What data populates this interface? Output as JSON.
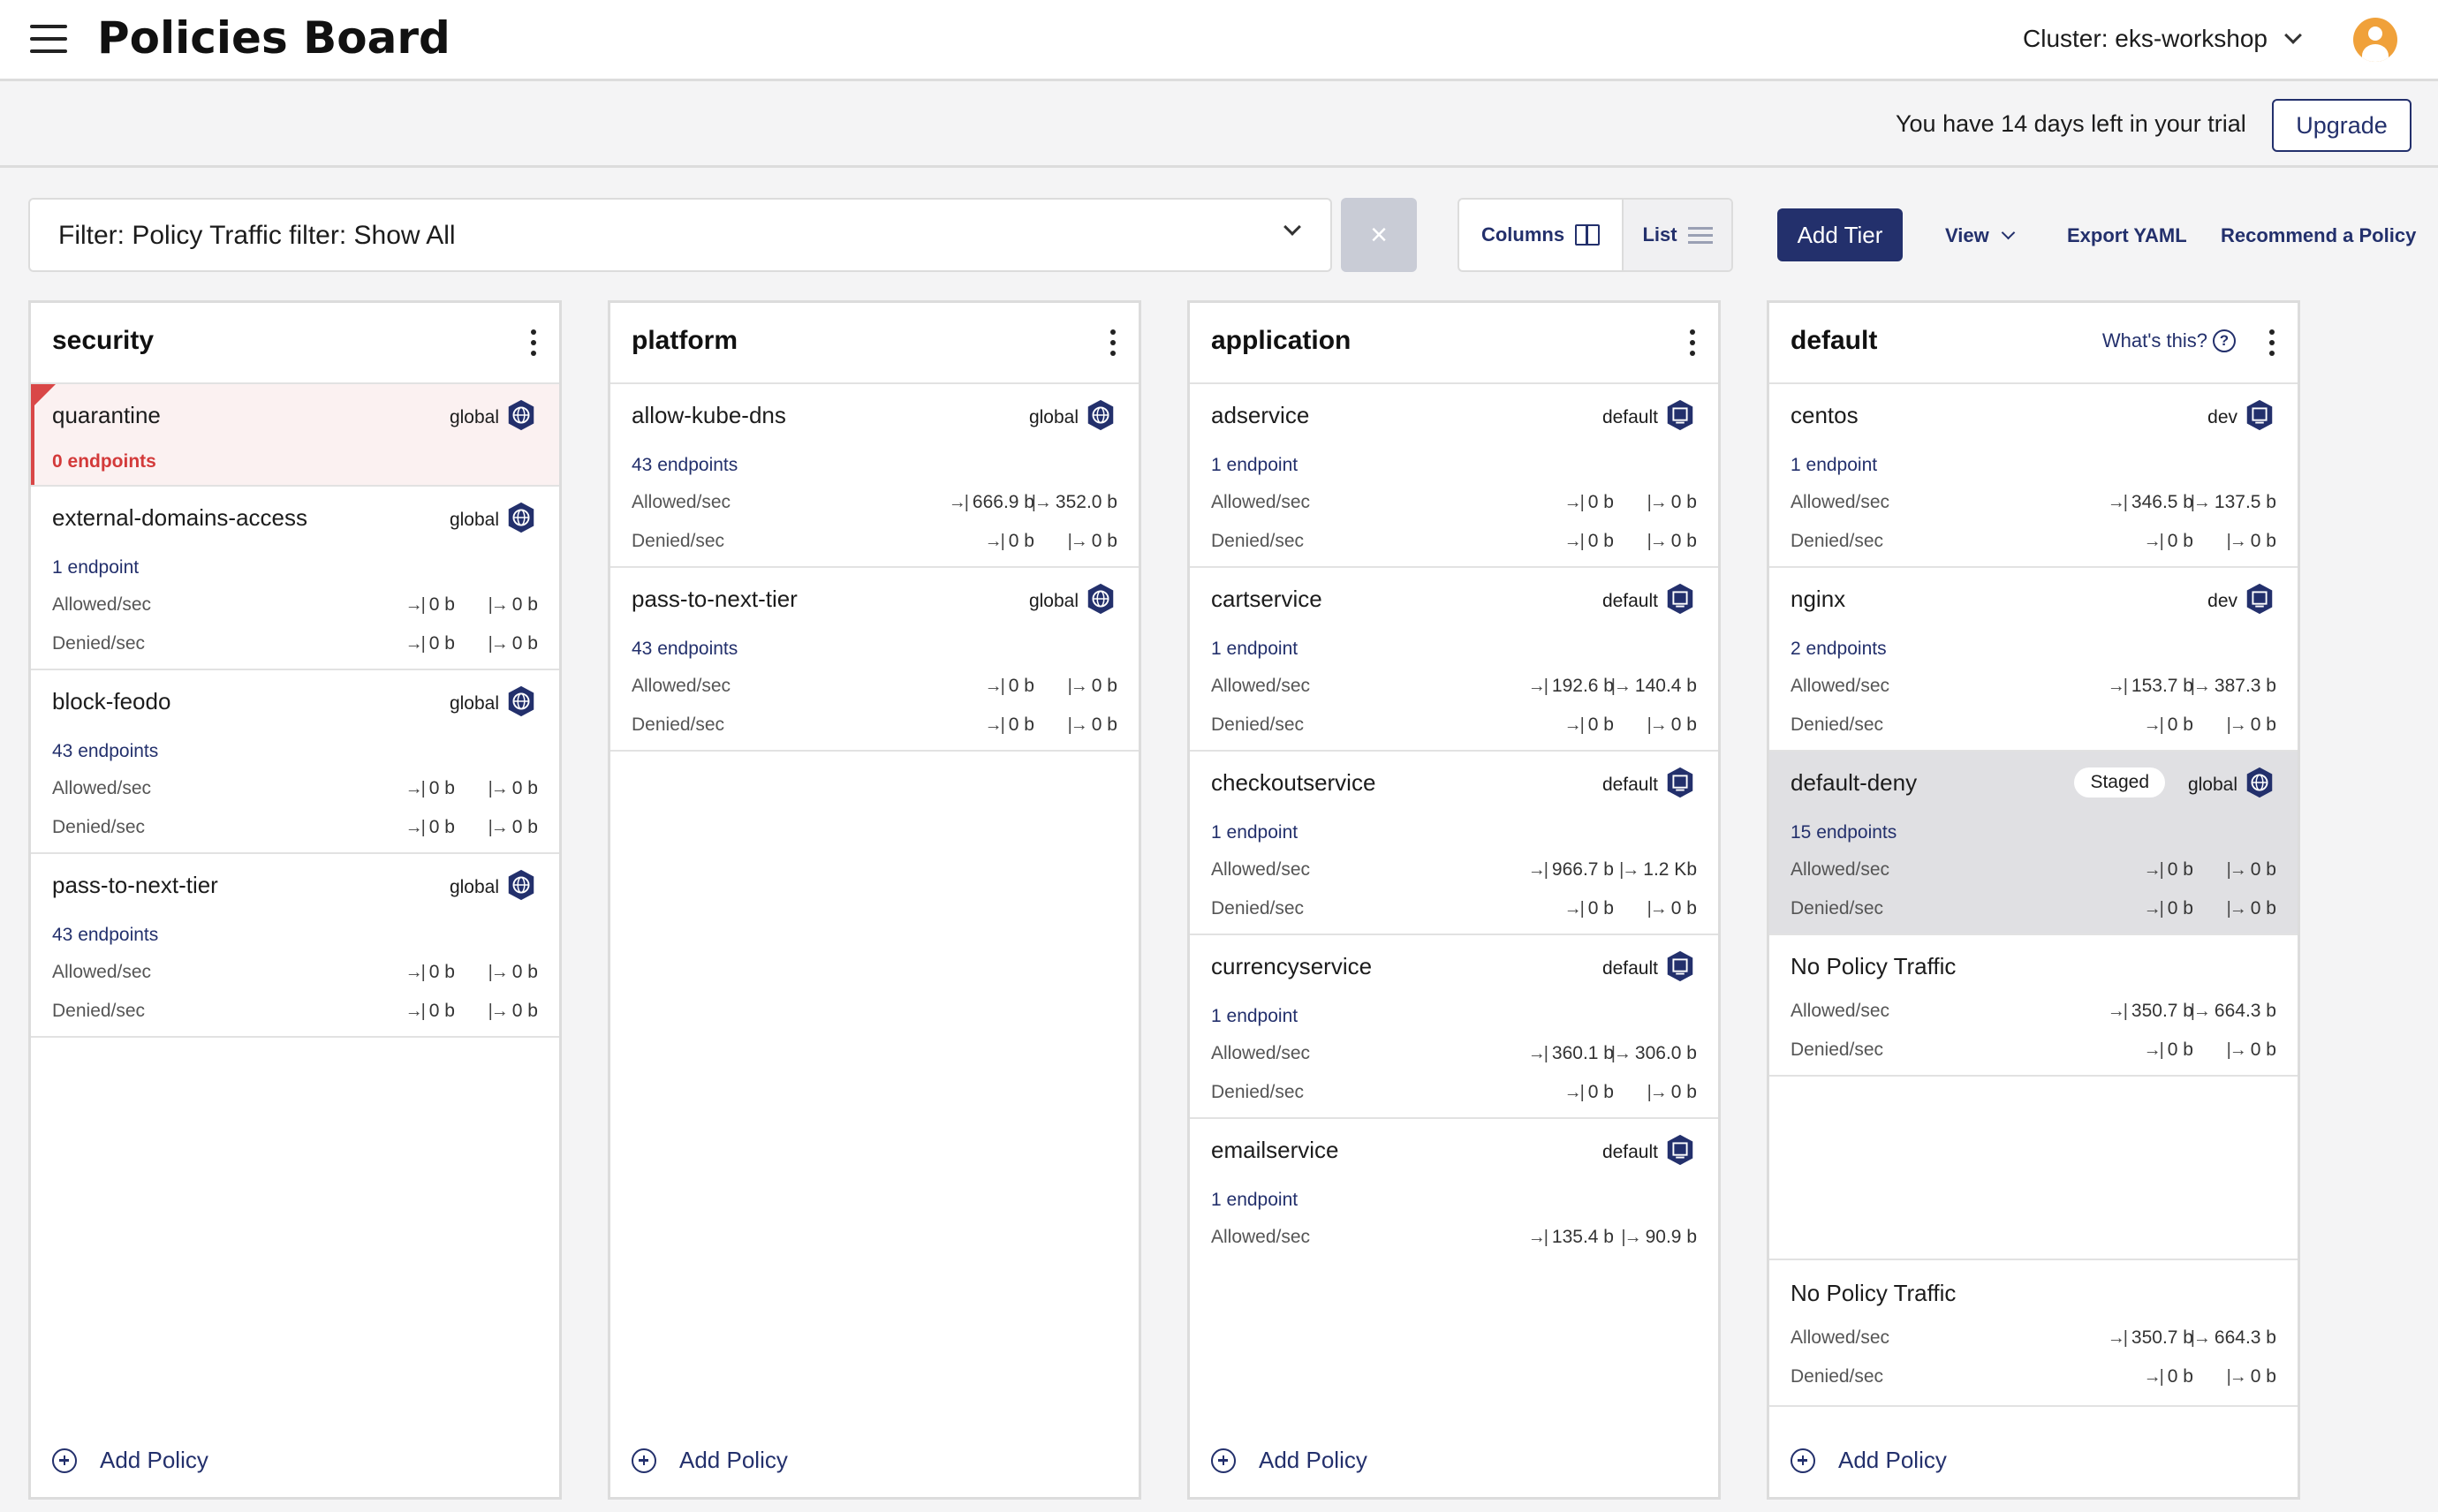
{
  "header": {
    "title": "Policies Board",
    "cluster": "Cluster: eks-workshop"
  },
  "trial": {
    "text": "You have 14 days left in your trial",
    "upgrade": "Upgrade"
  },
  "toolbar": {
    "filter": "Filter: Policy Traffic filter: Show All",
    "clear": "×",
    "columns": "Columns",
    "list": "List",
    "add_tier": "Add Tier",
    "view": "View",
    "export": "Export YAML",
    "recommend": "Recommend a Policy"
  },
  "labels": {
    "allowed": "Allowed/sec",
    "denied": "Denied/sec",
    "add_policy": "Add Policy",
    "whats_this": "What's this?",
    "staged": "Staged"
  },
  "columns": [
    {
      "title": "security",
      "policies": [
        {
          "name": "quarantine",
          "scope": "global",
          "endpoints": "0 endpoints"
        },
        {
          "name": "external-domains-access",
          "scope": "global",
          "endpoints": "1 endpoint",
          "allowed": [
            "0 b",
            "0 b"
          ],
          "denied": [
            "0 b",
            "0 b"
          ]
        },
        {
          "name": "block-feodo",
          "scope": "global",
          "endpoints": "43 endpoints",
          "allowed": [
            "0 b",
            "0 b"
          ],
          "denied": [
            "0 b",
            "0 b"
          ]
        },
        {
          "name": "pass-to-next-tier",
          "scope": "global",
          "endpoints": "43 endpoints",
          "allowed": [
            "0 b",
            "0 b"
          ],
          "denied": [
            "0 b",
            "0 b"
          ]
        }
      ]
    },
    {
      "title": "platform",
      "policies": [
        {
          "name": "allow-kube-dns",
          "scope": "global",
          "endpoints": "43 endpoints",
          "allowed": [
            "666.9 b",
            "352.0 b"
          ],
          "denied": [
            "0 b",
            "0 b"
          ]
        },
        {
          "name": "pass-to-next-tier",
          "scope": "global",
          "endpoints": "43 endpoints",
          "allowed": [
            "0 b",
            "0 b"
          ],
          "denied": [
            "0 b",
            "0 b"
          ]
        }
      ]
    },
    {
      "title": "application",
      "policies": [
        {
          "name": "adservice",
          "scope": "default",
          "endpoints": "1 endpoint",
          "allowed": [
            "0 b",
            "0 b"
          ],
          "denied": [
            "0 b",
            "0 b"
          ]
        },
        {
          "name": "cartservice",
          "scope": "default",
          "endpoints": "1 endpoint",
          "allowed": [
            "192.6 b",
            "140.4 b"
          ],
          "denied": [
            "0 b",
            "0 b"
          ]
        },
        {
          "name": "checkoutservice",
          "scope": "default",
          "endpoints": "1 endpoint",
          "allowed": [
            "966.7 b",
            "1.2 Kb"
          ],
          "denied": [
            "0 b",
            "0 b"
          ]
        },
        {
          "name": "currencyservice",
          "scope": "default",
          "endpoints": "1 endpoint",
          "allowed": [
            "360.1 b",
            "306.0 b"
          ],
          "denied": [
            "0 b",
            "0 b"
          ]
        },
        {
          "name": "emailservice",
          "scope": "default",
          "endpoints": "1 endpoint",
          "allowed": [
            "135.4 b",
            "90.9 b"
          ]
        }
      ]
    },
    {
      "title": "default",
      "policies": [
        {
          "name": "centos",
          "scope": "dev",
          "endpoints": "1 endpoint",
          "allowed": [
            "346.5 b",
            "137.5 b"
          ],
          "denied": [
            "0 b",
            "0 b"
          ]
        },
        {
          "name": "nginx",
          "scope": "dev",
          "endpoints": "2 endpoints",
          "allowed": [
            "153.7 b",
            "387.3 b"
          ],
          "denied": [
            "0 b",
            "0 b"
          ]
        },
        {
          "name": "default-deny",
          "scope": "global",
          "endpoints": "15 endpoints",
          "allowed": [
            "0 b",
            "0 b"
          ],
          "denied": [
            "0 b",
            "0 b"
          ]
        },
        {
          "name": "No Policy Traffic",
          "allowed": [
            "350.7 b",
            "664.3 b"
          ],
          "denied": [
            "0 b",
            "0 b"
          ]
        },
        {
          "name": "No Policy Traffic",
          "allowed": [
            "350.7 b",
            "664.3 b"
          ],
          "denied": [
            "0 b",
            "0 b"
          ]
        }
      ]
    }
  ],
  "icons": {
    "global": "globe-hex-icon",
    "namespace": "namespace-hex-icon",
    "ingress": "ingress-arrow-icon",
    "egress": "egress-arrow-icon"
  },
  "colors": {
    "navy": "#23306c",
    "alert": "#d94747"
  }
}
